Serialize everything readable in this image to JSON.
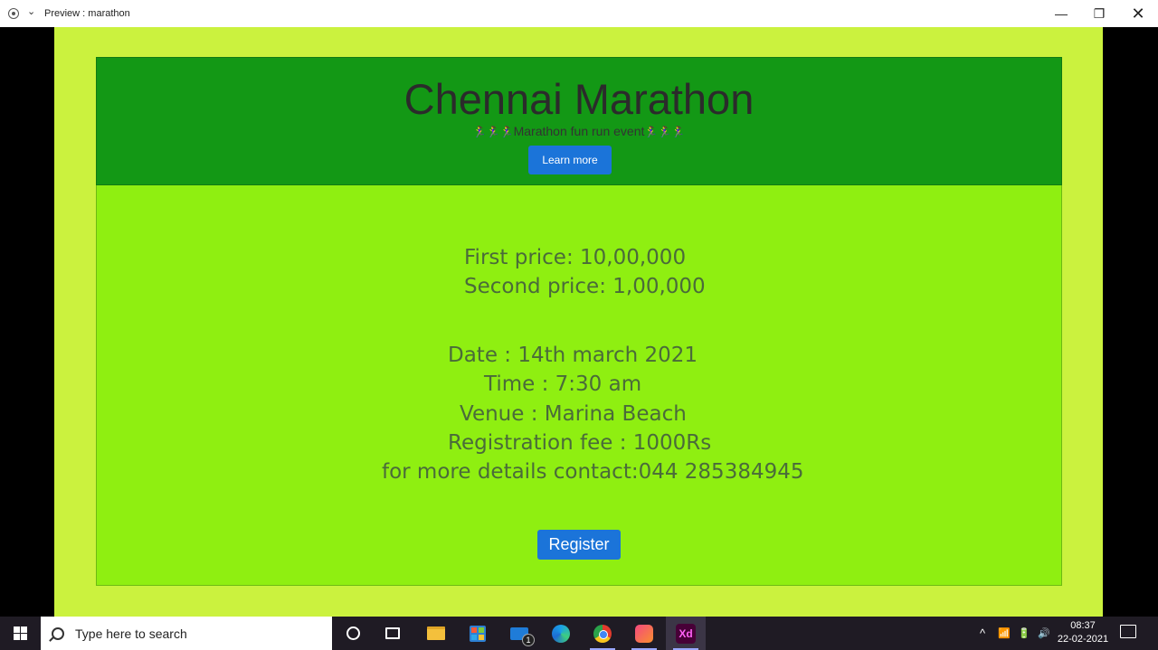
{
  "window": {
    "title": "Preview : marathon",
    "chevron": "⌄",
    "minimize": "—",
    "maximize": "❐",
    "close": "✕"
  },
  "hero": {
    "title": "Chennai Marathon",
    "runner_icons": "🏃‍♀️🏃‍♀️🏃‍♀️",
    "subtitle": "Marathon fun run event",
    "runner_icons_after": "🏃‍♀️🏃‍♀️🏃‍♀️",
    "learn_more_label": "Learn more"
  },
  "prizes": {
    "first": "First price: 10,00,000",
    "second": "Second price: 1,00,000"
  },
  "details": {
    "date": "Date : 14th march 2021",
    "time": "Time : 7:30 am",
    "venue": "Venue : Marina Beach",
    "fee": "Registration fee : 1000Rs",
    "contact": "for more details contact:044 285384945"
  },
  "register_label": "Register",
  "taskbar": {
    "search_placeholder": "Type here to search",
    "mail_badge": "1",
    "xd_label": "Xd",
    "time": "08:37",
    "date": "22-02-2021",
    "tray_up": "^",
    "tray_wifi": "📶",
    "tray_battery": "🔋",
    "tray_volume": "🔊"
  },
  "icons": [
    "windows-logo",
    "search-icon",
    "cortana-icon",
    "task-view-icon",
    "file-explorer-icon",
    "store-icon",
    "mail-icon",
    "edge-icon",
    "chrome-icon",
    "creative-cloud-icon",
    "xd-icon",
    "notification-icon"
  ]
}
